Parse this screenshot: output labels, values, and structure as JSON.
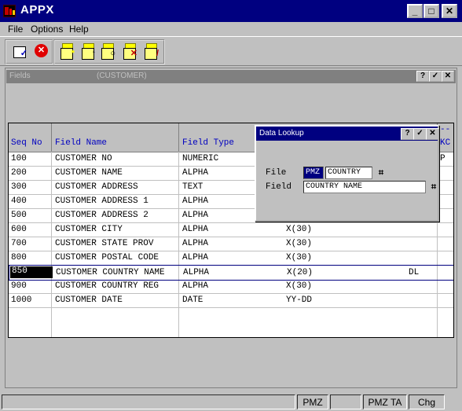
{
  "window": {
    "title": "APPX",
    "minimize_label": "_",
    "maximize_label": "□",
    "close_label": "✕"
  },
  "menu": {
    "items": [
      "File",
      "Options",
      "Help"
    ]
  },
  "toolbar": {
    "tools": [
      "check-doc-icon",
      "cancel-icon",
      "new-folder-icon",
      "open-folder-icon",
      "search-folder-icon",
      "delete-folder-icon",
      "edit-folder-icon"
    ]
  },
  "fields_window": {
    "title": "Fields",
    "subtitle": "(CUSTOMER)",
    "help_label": "?",
    "ok_label": "✓",
    "close_label": "✕"
  },
  "grid": {
    "headers": [
      "Seq No",
      "Field Name",
      "Field Type"
    ],
    "right_header_top": "--",
    "right_header": "KC",
    "rows": [
      {
        "seq": "100",
        "name": "CUSTOMER NO",
        "type": "NUMERIC",
        "format": "",
        "extra": "",
        "kc": "P"
      },
      {
        "seq": "200",
        "name": "CUSTOMER NAME",
        "type": "ALPHA",
        "format": "",
        "extra": "",
        "kc": ""
      },
      {
        "seq": "300",
        "name": "CUSTOMER ADDRESS",
        "type": "TEXT",
        "format": "",
        "extra": "",
        "kc": ""
      },
      {
        "seq": "400",
        "name": "CUSTOMER ADDRESS 1",
        "type": "ALPHA",
        "format": "",
        "extra": "",
        "kc": ""
      },
      {
        "seq": "500",
        "name": "CUSTOMER ADDRESS 2",
        "type": "ALPHA",
        "format": "",
        "extra": "",
        "kc": ""
      },
      {
        "seq": "600",
        "name": "CUSTOMER CITY",
        "type": "ALPHA",
        "format": "X(30)",
        "extra": "",
        "kc": ""
      },
      {
        "seq": "700",
        "name": "CUSTOMER STATE PROV",
        "type": "ALPHA",
        "format": "X(30)",
        "extra": "",
        "kc": ""
      },
      {
        "seq": "800",
        "name": "CUSTOMER POSTAL CODE",
        "type": "ALPHA",
        "format": "X(30)",
        "extra": "",
        "kc": ""
      },
      {
        "seq": "850",
        "name": "CUSTOMER COUNTRY NAME",
        "type": "ALPHA",
        "format": "X(20)",
        "extra": "DL",
        "kc": ""
      },
      {
        "seq": "900",
        "name": "CUSTOMER COUNTRY REG",
        "type": "ALPHA",
        "format": "X(30)",
        "extra": "",
        "kc": ""
      },
      {
        "seq": "1000",
        "name": "CUSTOMER DATE",
        "type": "DATE",
        "format": "YY-DD",
        "extra": "",
        "kc": ""
      }
    ]
  },
  "lookup": {
    "title": "Data Lookup",
    "help_label": "?",
    "ok_label": "✓",
    "close_label": "✕",
    "file_label": "File",
    "file_app": "PMZ",
    "file_value": "COUNTRY",
    "field_label": "Field",
    "field_value": "COUNTRY NAME"
  },
  "status": {
    "panels": [
      "",
      "PMZ",
      "",
      "PMZ TA",
      "Chg"
    ]
  }
}
